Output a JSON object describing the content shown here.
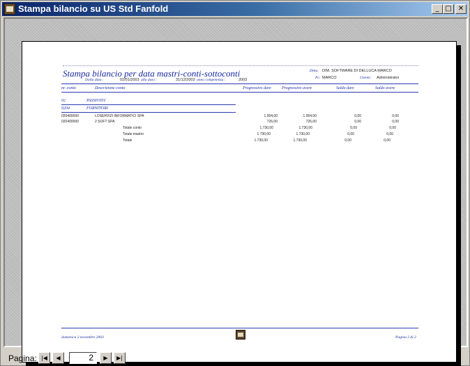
{
  "window": {
    "title": "Stampa bilancio su US Std Fanfold"
  },
  "report": {
    "title": "Stampa bilancio per data mastri-conti-sottoconti",
    "dalla_label": "Dalla data :",
    "dalla_value": "01/01/2003",
    "alla_label": "alla data :",
    "alla_value": "31/12/2003",
    "anno_label": "anno competenza :",
    "anno_value": "2003",
    "ditta_label": "Ditta:",
    "ditta_value": "DIM. SOFTWARE DI DELLUCA MARCO",
    "pc_label": "Pc:",
    "pc_value": "MARCO",
    "utente_label": "Utente:",
    "utente_value": "Administrator",
    "columns": [
      "nr. conto",
      "Descrizione conto",
      "Progressivo dare",
      "Progressivo avere",
      "Saldo dare",
      "Saldo avere"
    ],
    "mastro_code": "02",
    "mastro_desc": "PASSIVITA'",
    "conto_code": "0204",
    "conto_desc": "FORNITORI",
    "rows": [
      {
        "code": "020400000",
        "desc": "LOSERVIZI INFORMATICI SPA",
        "dare": "1.004,00",
        "avere": "1.004,00",
        "sdare": "0,00",
        "savere": "0,00"
      },
      {
        "code": "020400000",
        "desc": "2 SOFT SPA",
        "dare": "726,00",
        "avere": "726,00",
        "sdare": "0,00",
        "savere": "0,00"
      }
    ],
    "totals": [
      {
        "label": "Totale conto",
        "dare": "1.730,00",
        "avere": "1.730,00",
        "sdare": "0,00",
        "savere": "0,00"
      },
      {
        "label": "Totale mastro",
        "dare": "1.730,00",
        "avere": "1.730,00",
        "sdare": "0,00",
        "savere": "0,00"
      },
      {
        "label": "Totale",
        "dare": "1.730,00",
        "avere": "1.730,00",
        "sdare": "0,00",
        "savere": "0,00"
      }
    ],
    "footer_left": "domenica 2 novembre 2003",
    "footer_right": "Pagina 2 di 2"
  },
  "navigation": {
    "label": "Pagina:",
    "page_number": "2",
    "first_icon": "first-page-icon",
    "prev_icon": "prev-page-icon",
    "next_icon": "next-page-icon",
    "last_icon": "last-page-icon"
  }
}
